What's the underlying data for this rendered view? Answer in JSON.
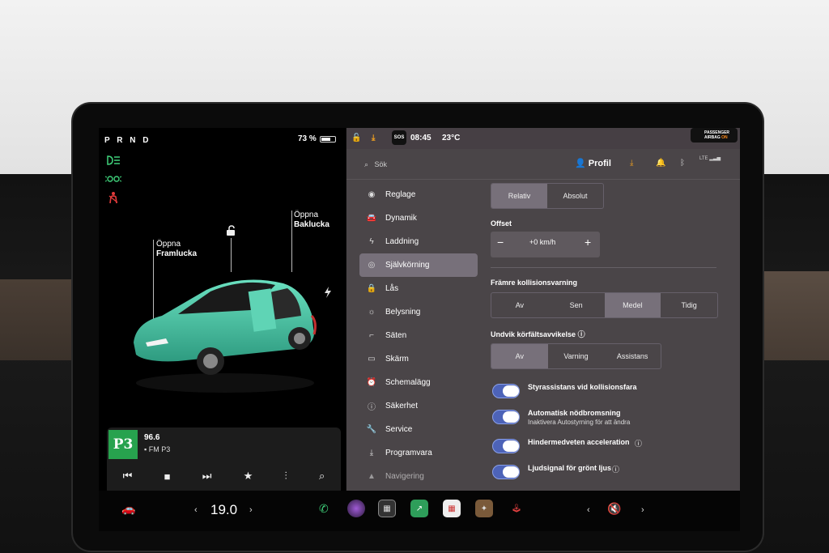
{
  "car_panel": {
    "gear": "P R N D",
    "battery_percent": "73 %",
    "battery_level": 0.73,
    "callouts": {
      "front_trunk_line1": "Öppna",
      "front_trunk_line2": "Framlucka",
      "rear_trunk_line1": "Öppna",
      "rear_trunk_line2": "Baklucka"
    },
    "car_color": "#4fc9a9"
  },
  "media": {
    "logo": "P3",
    "frequency": "96.6",
    "station": "FM P3"
  },
  "status_bar": {
    "sos": "SOS",
    "time": "08:45",
    "temperature": "23°C",
    "airbag_line1": "PASSENGER",
    "airbag_line2": "AIRBAG",
    "airbag_state": "ON"
  },
  "header": {
    "search_placeholder": "Sök",
    "profile_label": "Profil",
    "lte": "LTE"
  },
  "nav": {
    "items": [
      {
        "label": "Reglage",
        "icon": "toggle-icon"
      },
      {
        "label": "Dynamik",
        "icon": "car-icon"
      },
      {
        "label": "Laddning",
        "icon": "bolt-icon"
      },
      {
        "label": "Självkörning",
        "icon": "steering-wheel-icon"
      },
      {
        "label": "Lås",
        "icon": "lock-icon"
      },
      {
        "label": "Belysning",
        "icon": "sun-icon"
      },
      {
        "label": "Säten",
        "icon": "seat-icon"
      },
      {
        "label": "Skärm",
        "icon": "screen-icon"
      },
      {
        "label": "Schemalägg",
        "icon": "alarm-icon"
      },
      {
        "label": "Säkerhet",
        "icon": "info-icon"
      },
      {
        "label": "Service",
        "icon": "wrench-icon"
      },
      {
        "label": "Programvara",
        "icon": "download-icon"
      },
      {
        "label": "Navigering",
        "icon": "navigation-icon"
      }
    ]
  },
  "settings": {
    "speed_mode": {
      "options": [
        "Relativ",
        "Absolut"
      ],
      "selected": "Relativ"
    },
    "offset_label": "Offset",
    "offset_value": "+0 km/h",
    "collision_label": "Främre kollisionsvarning",
    "collision": {
      "options": [
        "Av",
        "Sen",
        "Medel",
        "Tidig"
      ],
      "selected": "Medel"
    },
    "lane_label": "Undvik körfältsavvikelse",
    "lane": {
      "options": [
        "Av",
        "Varning",
        "Assistans"
      ],
      "selected": "Av"
    },
    "toggles": [
      {
        "label": "Styrassistans vid kollisionsfara",
        "sub": "",
        "on": true
      },
      {
        "label": "Automatisk nödbromsning",
        "sub": "Inaktivera Autostyrning för att ändra",
        "on": true
      },
      {
        "label": "Hindermedveten acceleration",
        "sub": "",
        "on": true
      },
      {
        "label": "Ljudsignal för grönt ljus",
        "sub": "",
        "on": true
      }
    ]
  },
  "taskbar": {
    "temperature": "19.0",
    "accent": "#3e8ee0"
  }
}
